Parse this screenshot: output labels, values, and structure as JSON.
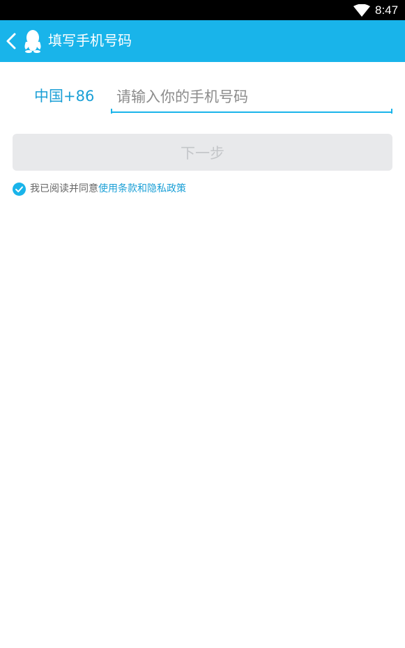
{
  "status_bar": {
    "time": "8:47",
    "icons": [
      "wifi-icon"
    ]
  },
  "app_bar": {
    "title": "填写手机号码",
    "back_icon": "chevron-left-icon",
    "logo_icon": "qq-penguin-icon",
    "background": "#19b4ea"
  },
  "form": {
    "country_code": "中国+86",
    "phone_placeholder": "请输入你的手机号码",
    "phone_value": "",
    "next_label": "下一步",
    "next_enabled": false
  },
  "agreement": {
    "checked": true,
    "text": "我已阅读并同意",
    "link_text": "使用条款和隐私政策"
  },
  "colors": {
    "accent": "#19b4ea",
    "link": "#1a9fd6",
    "button_disabled_bg": "#e8e9eb",
    "button_disabled_text": "#c4c6c9"
  }
}
